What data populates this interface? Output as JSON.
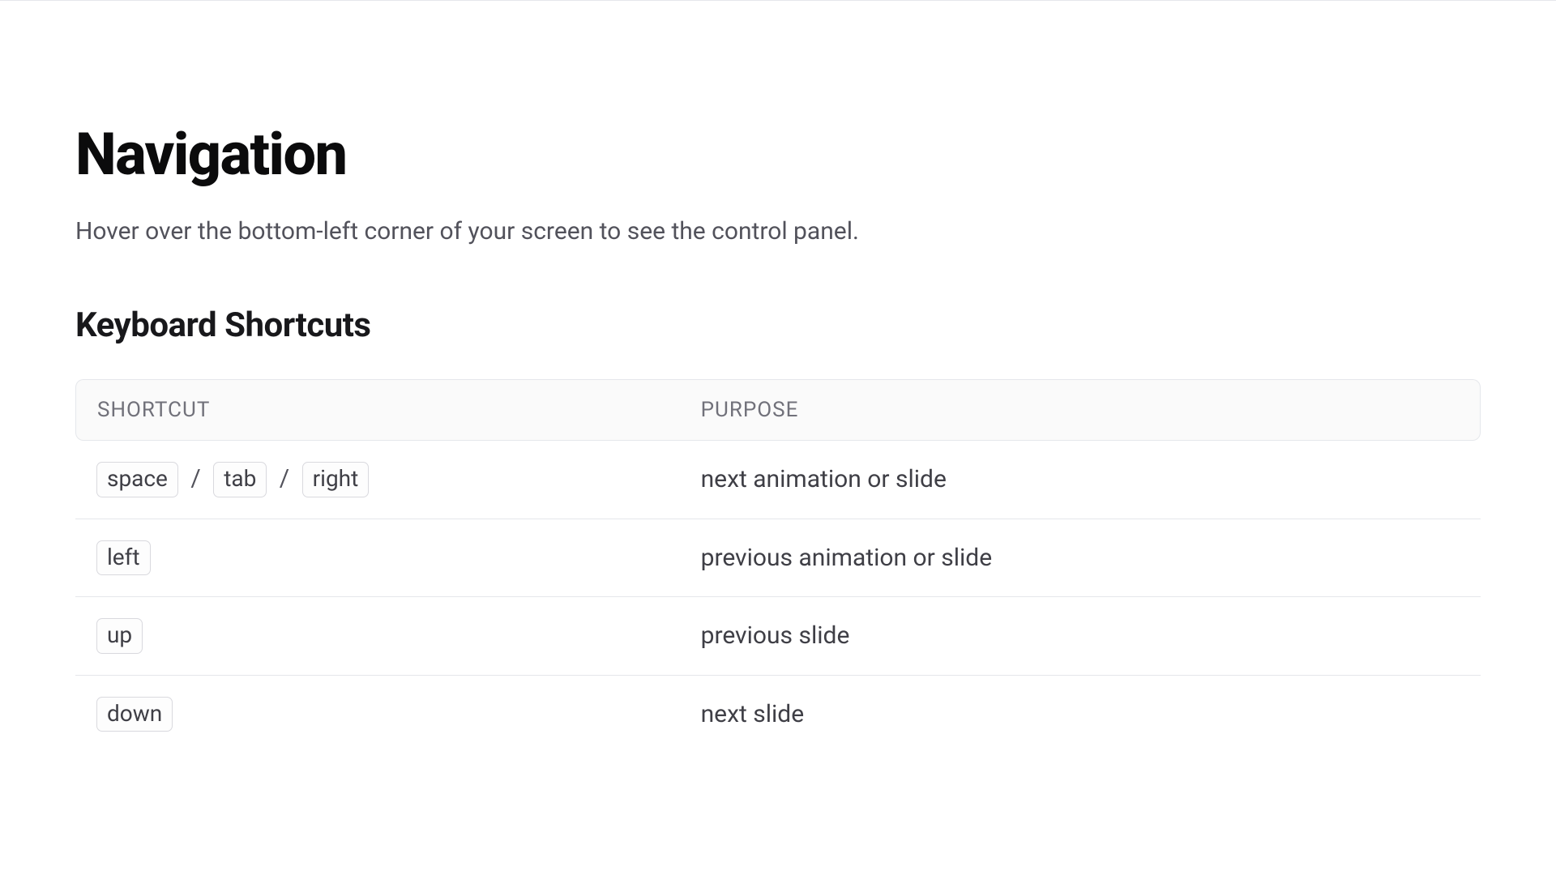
{
  "page": {
    "title": "Navigation",
    "subtitle": "Hover over the bottom-left corner of your screen to see the control panel.",
    "section_title": "Keyboard Shortcuts"
  },
  "table": {
    "headers": {
      "shortcut": "SHORTCUT",
      "purpose": "PURPOSE"
    },
    "rows": [
      {
        "keys": [
          "space",
          "tab",
          "right"
        ],
        "purpose": "next animation or slide"
      },
      {
        "keys": [
          "left"
        ],
        "purpose": "previous animation or slide"
      },
      {
        "keys": [
          "up"
        ],
        "purpose": "previous slide"
      },
      {
        "keys": [
          "down"
        ],
        "purpose": "next slide"
      }
    ],
    "separator": "/"
  }
}
